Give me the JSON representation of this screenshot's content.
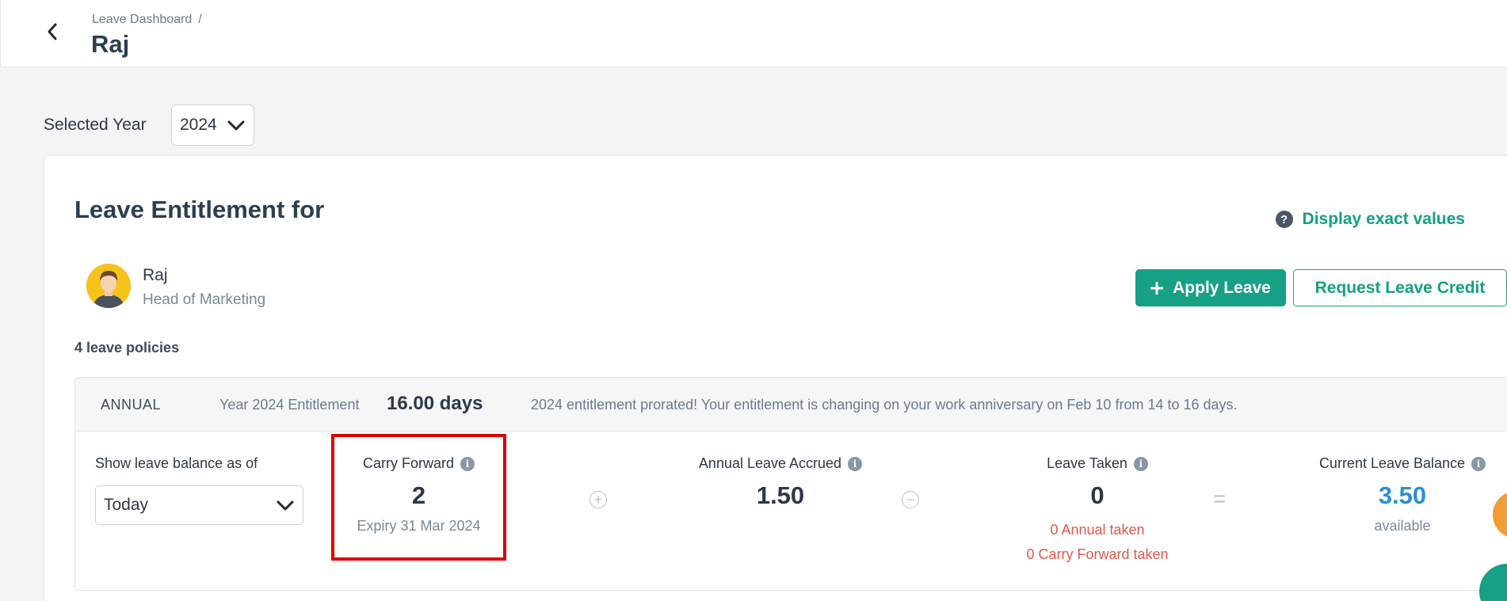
{
  "header": {
    "breadcrumb": "Leave Dashboard",
    "breadcrumb_sep": "/",
    "title": "Raj",
    "back_icon": "chevron-left-icon"
  },
  "year_filter": {
    "label": "Selected Year",
    "value": "2024"
  },
  "entitlement": {
    "title": "Leave Entitlement for",
    "display_exact_label": "Display exact values",
    "help_icon": "question-circle-icon"
  },
  "employee": {
    "name": "Raj",
    "role": "Head of Marketing"
  },
  "actions": {
    "apply_label": "Apply Leave",
    "request_credit_label": "Request Leave Credit"
  },
  "policies_count": "4 leave policies",
  "policy": {
    "type": "ANNUAL",
    "entitlement_label": "Year 2024 Entitlement",
    "entitlement_value": "16.00 days",
    "note": "2024 entitlement prorated! Your entitlement is changing on your work anniversary on Feb 10 from 14 to 16 days.",
    "balance_as_of_label": "Show leave balance as of",
    "balance_as_of_value": "Today",
    "carry_forward": {
      "label": "Carry Forward",
      "value": "2",
      "expiry": "Expiry 31 Mar 2024"
    },
    "accrued": {
      "label": "Annual Leave Accrued",
      "value": "1.50"
    },
    "taken": {
      "label": "Leave Taken",
      "value": "0",
      "annual_taken": "0 Annual taken",
      "carry_forward_taken": "0 Carry Forward taken"
    },
    "balance": {
      "label": "Current Leave Balance",
      "value": "3.50",
      "sub": "available"
    }
  },
  "colors": {
    "brand_green": "#16a085",
    "balance_blue": "#2b8fd6",
    "taken_red": "#e2574c",
    "highlight_red": "#e00000"
  }
}
